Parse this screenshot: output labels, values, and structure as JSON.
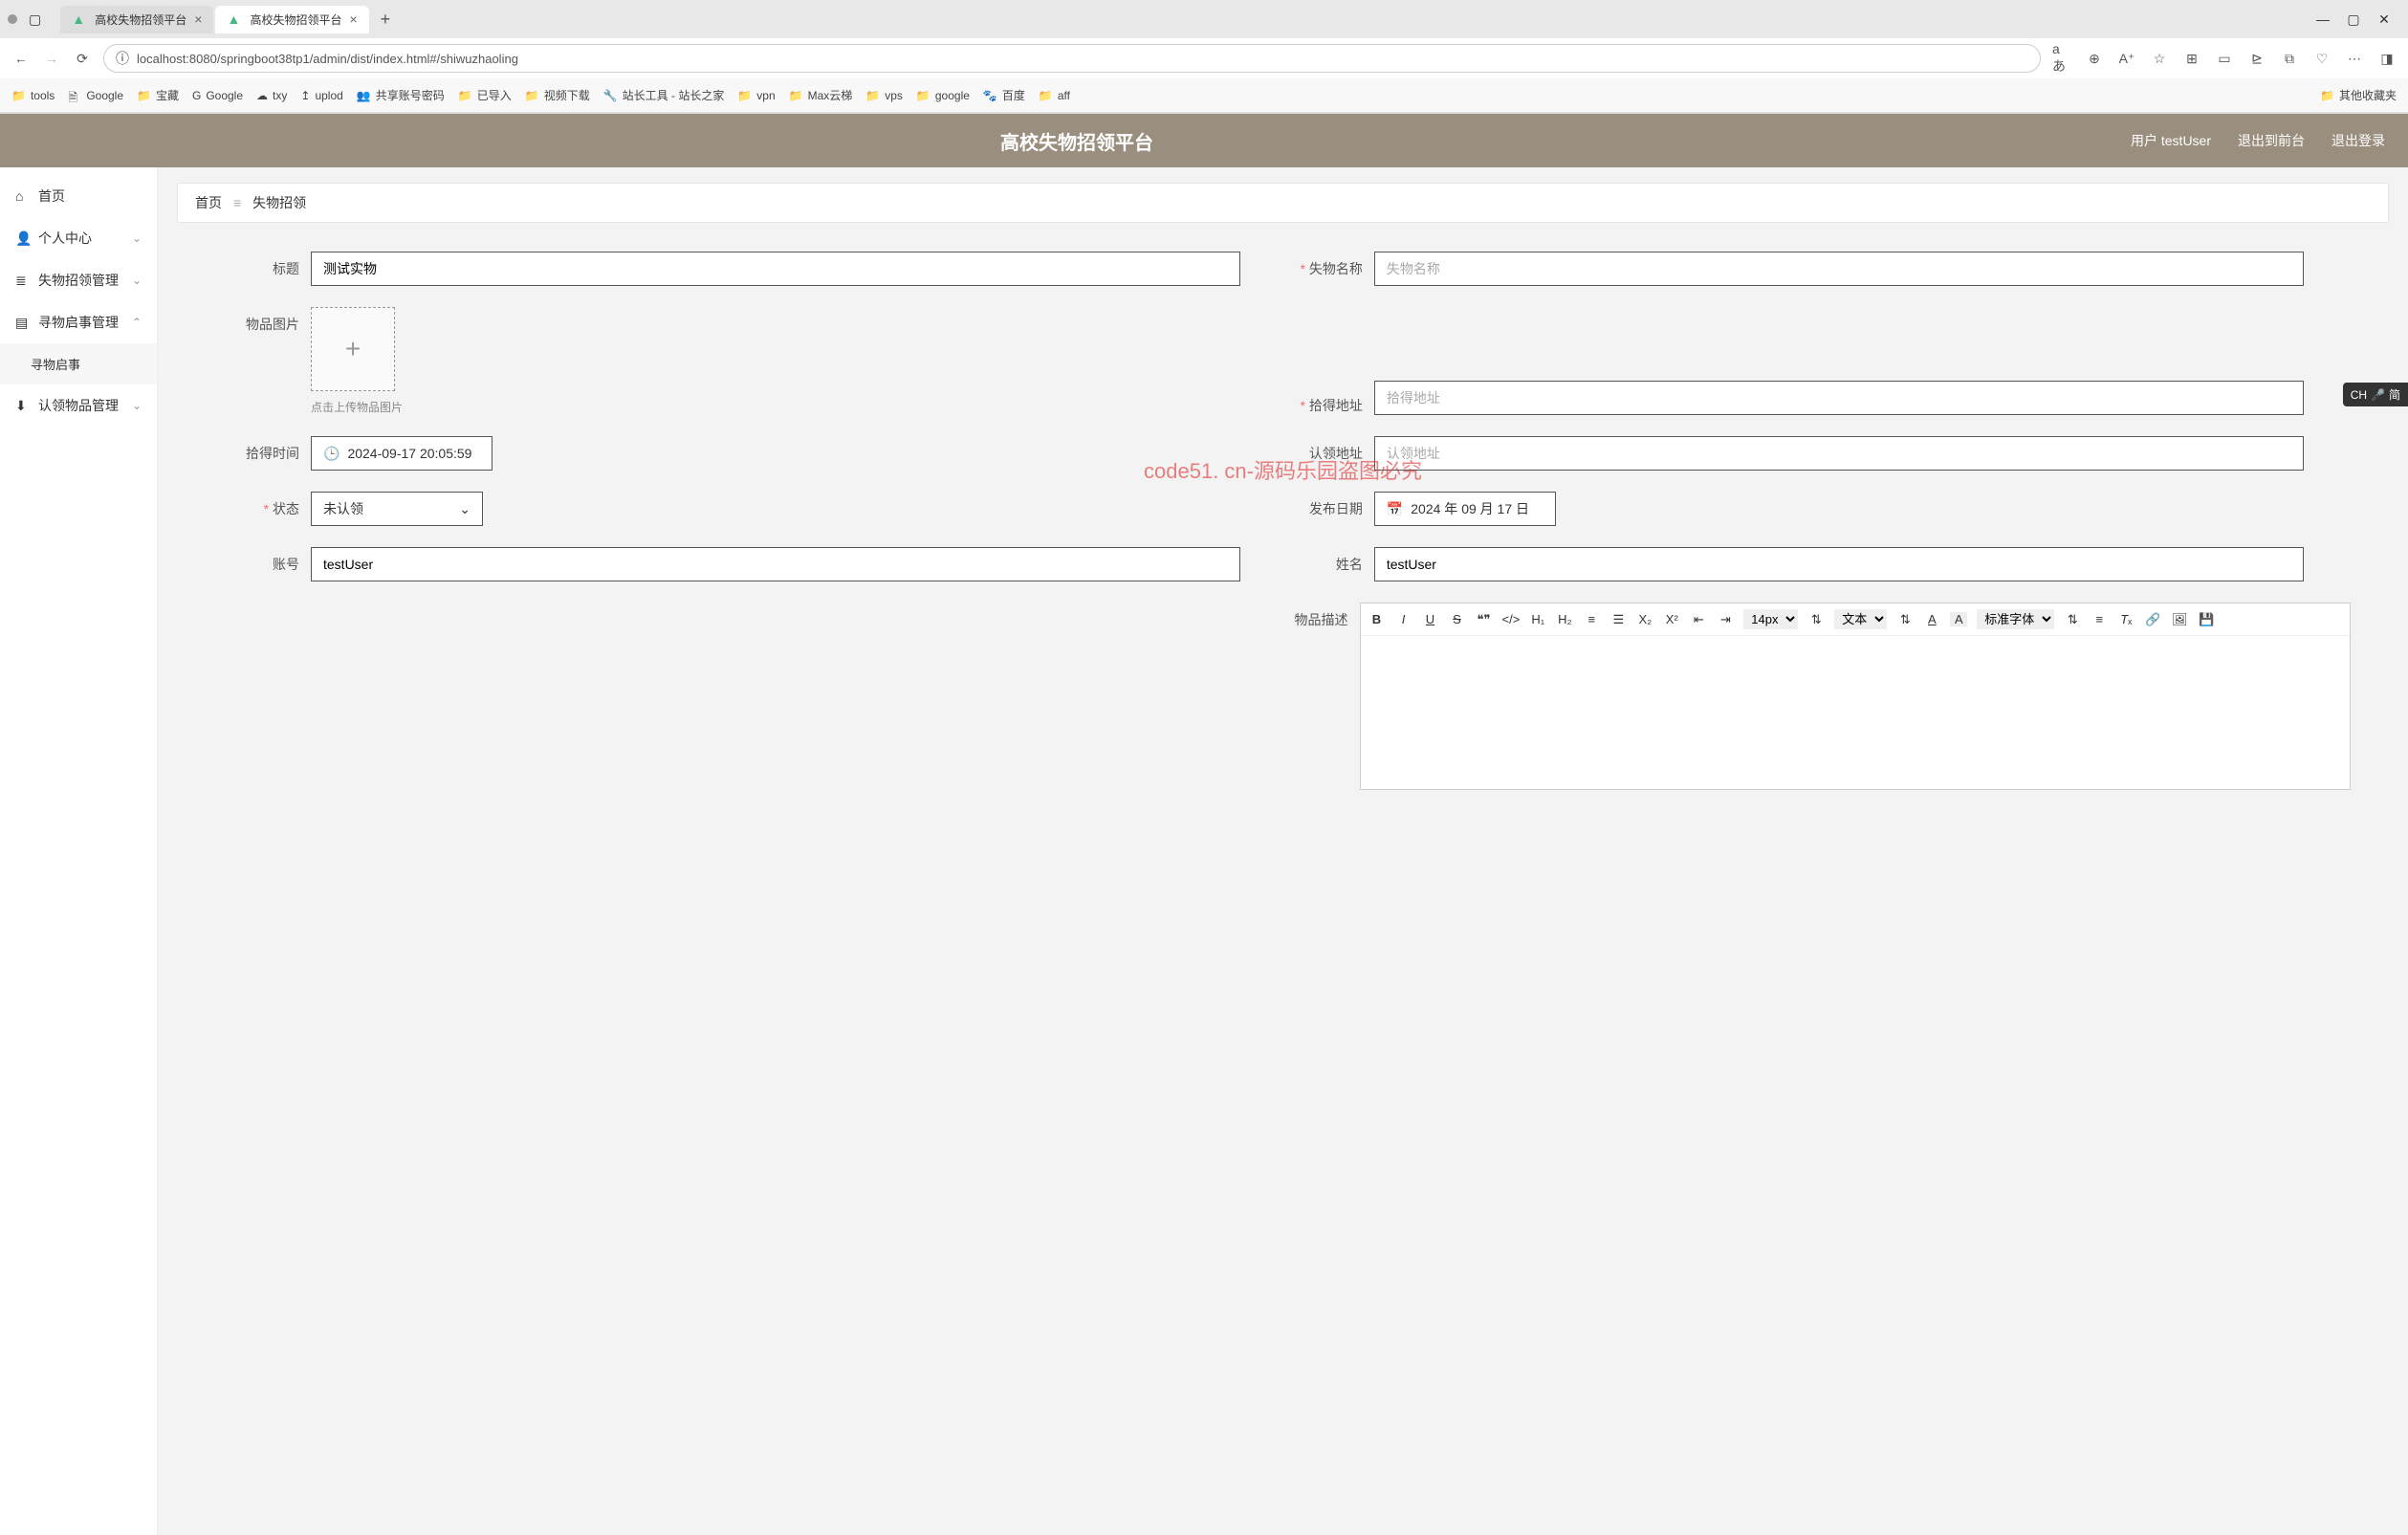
{
  "browser": {
    "tabs": [
      {
        "title": "高校失物招领平台",
        "active": false
      },
      {
        "title": "高校失物招领平台",
        "active": true
      }
    ],
    "url": "localhost:8080/springboot38tp1/admin/dist/index.html#/shiwuzhaoling"
  },
  "bookmarks": {
    "items": [
      "tools",
      "Google",
      "宝藏",
      "Google",
      "txy",
      "uplod",
      "共享账号密码",
      "已导入",
      "视频下载",
      "站长工具 - 站长之家",
      "vpn",
      "Max云梯",
      "vps",
      "google",
      "百度",
      "aff"
    ],
    "overflow": "其他收藏夹"
  },
  "header": {
    "title": "高校失物招领平台",
    "user_label": "用户 testUser",
    "back_label": "退出到前台",
    "logout_label": "退出登录"
  },
  "sidebar": {
    "items": [
      {
        "icon": "home",
        "label": "首页",
        "expandable": false
      },
      {
        "icon": "user",
        "label": "个人中心",
        "expandable": true,
        "expanded": false
      },
      {
        "icon": "bars",
        "label": "失物招领管理",
        "expandable": true,
        "expanded": false
      },
      {
        "icon": "book",
        "label": "寻物启事管理",
        "expandable": true,
        "expanded": true
      },
      {
        "icon": "",
        "label": "寻物启事",
        "sub": true
      },
      {
        "icon": "claim",
        "label": "认领物品管理",
        "expandable": true,
        "expanded": false
      }
    ]
  },
  "breadcrumb": {
    "home": "首页",
    "current": "失物招领"
  },
  "form": {
    "title_label": "标题",
    "title_value": "测试实物",
    "lostname_label": "失物名称",
    "lostname_placeholder": "失物名称",
    "image_label": "物品图片",
    "image_hint": "点击上传物品图片",
    "pickaddr_label": "拾得地址",
    "pickaddr_placeholder": "拾得地址",
    "picktime_label": "拾得时间",
    "picktime_value": "2024-09-17 20:05:59",
    "claimaddr_label": "认领地址",
    "claimaddr_placeholder": "认领地址",
    "status_label": "状态",
    "status_value": "未认领",
    "pubdate_label": "发布日期",
    "pubdate_value": "2024 年 09 月 17 日",
    "account_label": "账号",
    "account_value": "testUser",
    "name_label": "姓名",
    "name_value": "testUser",
    "desc_label": "物品描述"
  },
  "rte": {
    "fontsize": "14px",
    "texttype": "文本",
    "font": "标准字体"
  },
  "watermark": "code51. cn-源码乐园盗图必究",
  "ime": {
    "lang": "CH",
    "mode": "简"
  }
}
